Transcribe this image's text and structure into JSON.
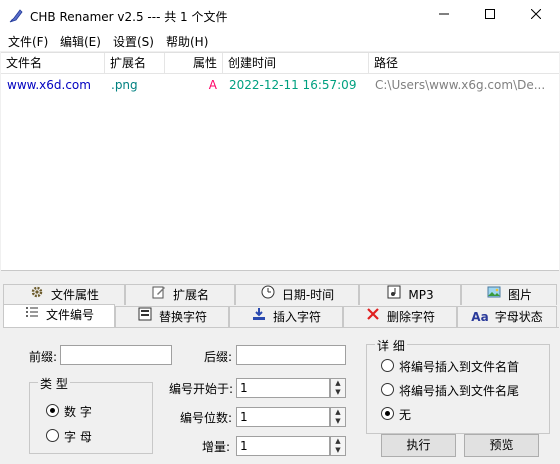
{
  "window": {
    "title": "CHB Renamer v2.5 --- 共 1 个文件"
  },
  "menu": [
    "文件(F)",
    "编辑(E)",
    "设置(S)",
    "帮助(H)"
  ],
  "list": {
    "columns": [
      "文件名",
      "扩展名",
      "属性",
      "创建时间",
      "路径"
    ],
    "rows": [
      {
        "name": "www.x6d.com",
        "ext": ".png",
        "attr": "A",
        "created": "2022-12-11 16:57:09",
        "path": "C:\\Users\\www.x6g.com\\De..."
      }
    ],
    "colors": {
      "name": "#0000c0",
      "ext": "#008080",
      "attr": "#ff0066",
      "created": "#00a080",
      "path": "#808080"
    }
  },
  "tabs_row1": [
    {
      "label": "文件属性",
      "icon": "gear-icon"
    },
    {
      "label": "扩展名",
      "icon": "edit-icon"
    },
    {
      "label": "日期-时间",
      "icon": "clock-icon"
    },
    {
      "label": "MP3",
      "icon": "music-icon"
    },
    {
      "label": "图片",
      "icon": "image-icon"
    }
  ],
  "tabs_row2": [
    {
      "label": "文件编号",
      "icon": "list-icon"
    },
    {
      "label": "替换字符",
      "icon": "replace-icon"
    },
    {
      "label": "插入字符",
      "icon": "insert-icon"
    },
    {
      "label": "删除字符",
      "icon": "delete-icon"
    },
    {
      "label": "字母状态",
      "icon": "letter-case-icon",
      "icon_text": "Aa"
    }
  ],
  "form": {
    "prefix_label": "前缀:",
    "suffix_label": "后缀:",
    "prefix_value": "",
    "suffix_value": "",
    "type_group": "类 型",
    "type_number": "数 字",
    "type_letter": "字 母",
    "start_label": "编号开始于:",
    "start_value": "1",
    "digits_label": "编号位数:",
    "digits_value": "1",
    "increment_label": "增量:",
    "increment_value": "1",
    "detail_group": "详 细",
    "detail_opt1": "将编号插入到文件名首",
    "detail_opt2": "将编号插入到文件名尾",
    "detail_opt3": "无",
    "execute": "执行",
    "preview": "预览"
  }
}
